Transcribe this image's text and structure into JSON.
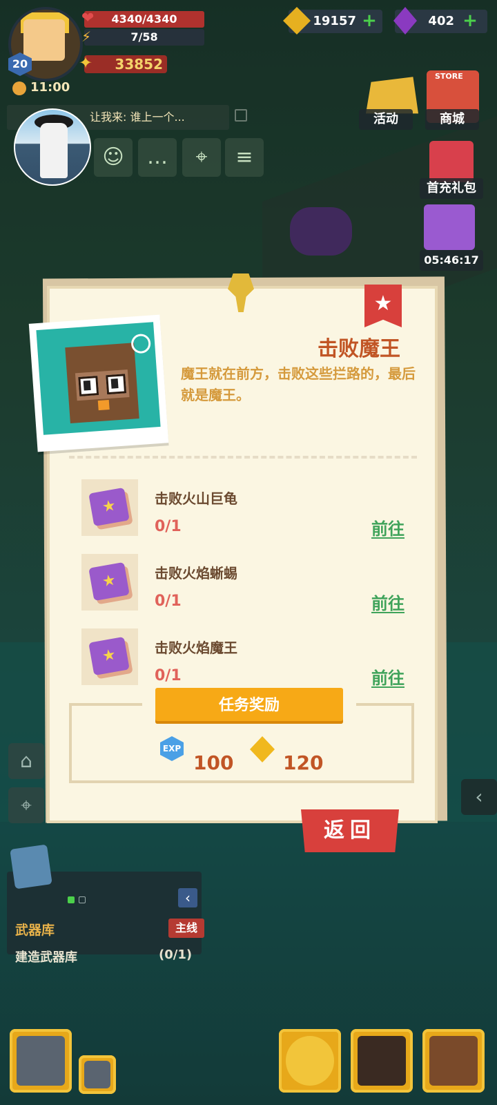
{
  "hud": {
    "level": "20",
    "hp": "4340/4340",
    "energy": "7/58",
    "power": "33852",
    "time": "11:00",
    "gold": "19157",
    "gems": "402"
  },
  "chat": {
    "text": "让我来: 谁上一个..."
  },
  "shop": {
    "activity": "活动",
    "store": "商城",
    "store_sign": "STORE",
    "first_recharge": "首充礼包",
    "gift_timer": "05:46:17"
  },
  "quest": {
    "title": "击败魔王",
    "description": "魔王就在前方，击败这些拦路的，最后就是魔王。",
    "tasks": [
      {
        "name": "击败火山巨龟",
        "progress": "0/1",
        "action": "前往"
      },
      {
        "name": "击败火焰蜥蜴",
        "progress": "0/1",
        "action": "前往"
      },
      {
        "name": "击败火焰魔王",
        "progress": "0/1",
        "action": "前往"
      }
    ],
    "reward_label": "任务奖励",
    "exp_icon_text": "EXP",
    "exp_value": "100",
    "coin_value": "120",
    "back_label": "返回"
  },
  "mission": {
    "category": "武器库",
    "tag": "主线",
    "task": "建造武器库",
    "progress": "(0/1)"
  },
  "colors": {
    "accent_orange": "#f7a916",
    "title_brown": "#c15525",
    "back_red": "#d8403c",
    "go_green": "#3fa35a"
  }
}
